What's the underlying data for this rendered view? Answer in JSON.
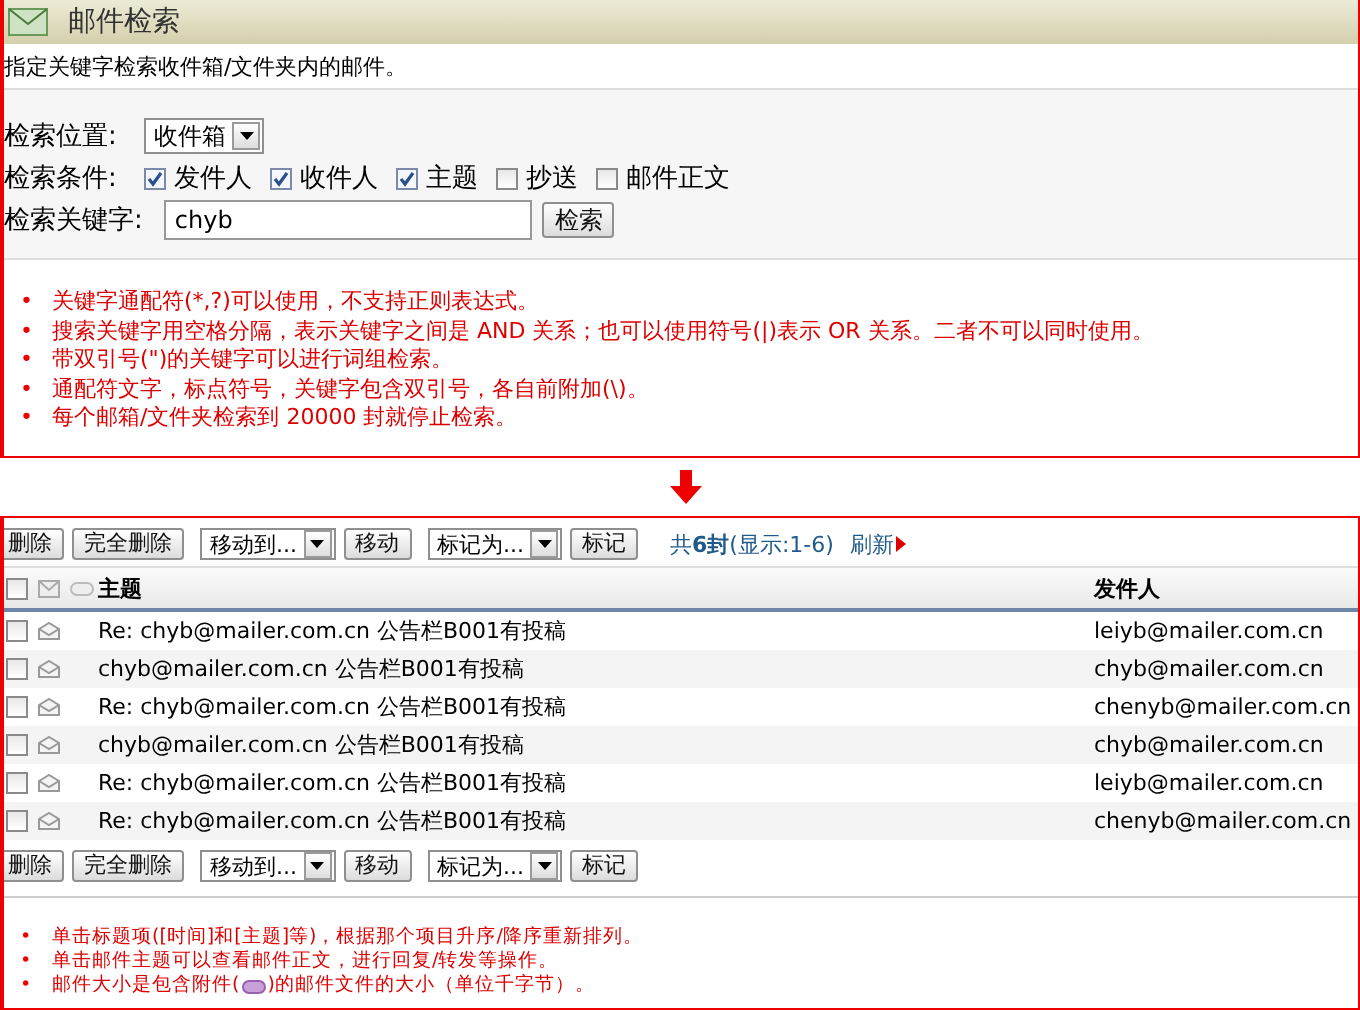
{
  "search_panel": {
    "title": "邮件检索",
    "description": "指定关键字检索收件箱/文件夹内的邮件。",
    "location": {
      "label": "检索位置:",
      "value": "收件箱"
    },
    "conditions": {
      "label": "检索条件:",
      "options": [
        {
          "label": "发件人",
          "checked": true
        },
        {
          "label": "收件人",
          "checked": true
        },
        {
          "label": "主题",
          "checked": true
        },
        {
          "label": "抄送",
          "checked": false
        },
        {
          "label": "邮件正文",
          "checked": false
        }
      ]
    },
    "keyword": {
      "label": "检索关键字:",
      "value": "chyb",
      "button": "检索"
    },
    "tips": [
      {
        "bullet": "•",
        "before": "关键字通配符(*,?)可以使用，不支持正则表达式。"
      },
      {
        "bullet": "•",
        "before": "搜索关键字用空格分隔，表示关键字之间是 AND 关系；也可以使用符号(|)表示 OR 关系。二者不可以同时使用。"
      },
      {
        "bullet": "•",
        "before": "带双引号(\")的关键字可以进行词组检索。"
      },
      {
        "bullet": "•",
        "before": "通配符文字，标点符号，关键字包含双引号，各自前附加(\\)。"
      },
      {
        "bullet": "•",
        "before": "每个邮箱/文件夹检索到 20000 封就停止检索。"
      }
    ]
  },
  "results_panel": {
    "top_toolbar": {
      "items": [
        {
          "kind": "button",
          "label": "删除"
        },
        {
          "kind": "button",
          "label": "完全删除"
        },
        {
          "kind": "dropdown",
          "label": "移动到..."
        },
        {
          "kind": "button",
          "label": "移动"
        },
        {
          "kind": "dropdown",
          "label": "标记为..."
        },
        {
          "kind": "button",
          "label": "标记"
        }
      ],
      "count": "共**6封**(显示:1-6)",
      "refresh": "刷新"
    },
    "table": {
      "select_all": {
        "checked": false
      },
      "columns": [
        "主题",
        "发件人"
      ],
      "rows": [
        {
          "checked": false,
          "subject": "Re: chyb@mailer.com.cn 公告栏B001有投稿",
          "sender": "leiyb@mailer.com.cn"
        },
        {
          "checked": false,
          "subject": "chyb@mailer.com.cn 公告栏B001有投稿",
          "sender": "chyb@mailer.com.cn"
        },
        {
          "checked": false,
          "subject": "Re: chyb@mailer.com.cn 公告栏B001有投稿",
          "sender": "chenyb@mailer.com.cn"
        },
        {
          "checked": false,
          "subject": "chyb@mailer.com.cn 公告栏B001有投稿",
          "sender": "chyb@mailer.com.cn"
        },
        {
          "checked": false,
          "subject": "Re: chyb@mailer.com.cn 公告栏B001有投稿",
          "sender": "leiyb@mailer.com.cn"
        },
        {
          "checked": false,
          "subject": "Re: chyb@mailer.com.cn 公告栏B001有投稿",
          "sender": "chenyb@mailer.com.cn"
        }
      ]
    },
    "bottom_toolbar": {
      "items": [
        {
          "kind": "button",
          "label": "删除"
        },
        {
          "kind": "button",
          "label": "完全删除"
        },
        {
          "kind": "dropdown",
          "label": "移动到..."
        },
        {
          "kind": "button",
          "label": "移动"
        },
        {
          "kind": "dropdown",
          "label": "标记为..."
        },
        {
          "kind": "button",
          "label": "标记"
        }
      ]
    },
    "tips": [
      {
        "bullet": "•",
        "before": "单击标题项([时间]和[主题]等)，根据那个项目升序/降序重新排列。"
      },
      {
        "bullet": "•",
        "before": "单击邮件主题可以查看邮件正文，进行回复/转发等操作。"
      },
      {
        "bullet": "•",
        "before": "邮件大小是包含附件(",
        "after": ")的邮件文件的大小（单位千字节）。"
      }
    ]
  }
}
